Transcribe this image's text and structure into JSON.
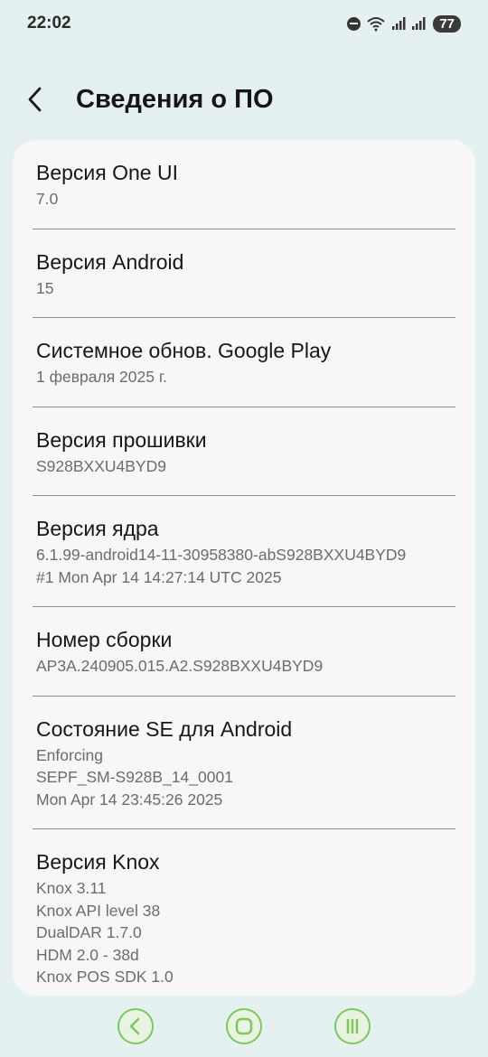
{
  "status": {
    "time": "22:02",
    "battery": "77"
  },
  "header": {
    "title": "Сведения о ПО"
  },
  "items": [
    {
      "title": "Версия One UI",
      "lines": [
        "7.0"
      ]
    },
    {
      "title": "Версия Android",
      "lines": [
        "15"
      ]
    },
    {
      "title": "Системное обнов. Google Play",
      "lines": [
        "1 февраля 2025 г."
      ]
    },
    {
      "title": "Версия прошивки",
      "lines": [
        "S928BXXU4BYD9"
      ]
    },
    {
      "title": "Версия ядра",
      "lines": [
        "6.1.99-android14-11-30958380-abS928BXXU4BYD9",
        "#1 Mon Apr 14 14:27:14 UTC 2025"
      ]
    },
    {
      "title": "Номер сборки",
      "lines": [
        "AP3A.240905.015.A2.S928BXXU4BYD9"
      ]
    },
    {
      "title": "Состояние SE для Android",
      "lines": [
        "Enforcing",
        "SEPF_SM-S928B_14_0001",
        "Mon Apr 14 23:45:26 2025"
      ]
    },
    {
      "title": "Версия Knox",
      "lines": [
        "Knox 3.11",
        "Knox API level 38",
        "DualDAR 1.7.0",
        "HDM 2.0 - 38d",
        "Knox POS SDK 1.0"
      ]
    }
  ],
  "colors": {
    "background": "#e4f1f0",
    "card": "#f7f7f7",
    "nav_accent": "#7cc95b"
  },
  "icons": {
    "back": "back-arrow-icon",
    "nav_back": "nav-back-icon",
    "nav_home": "nav-home-icon",
    "nav_recents": "nav-recents-icon"
  }
}
